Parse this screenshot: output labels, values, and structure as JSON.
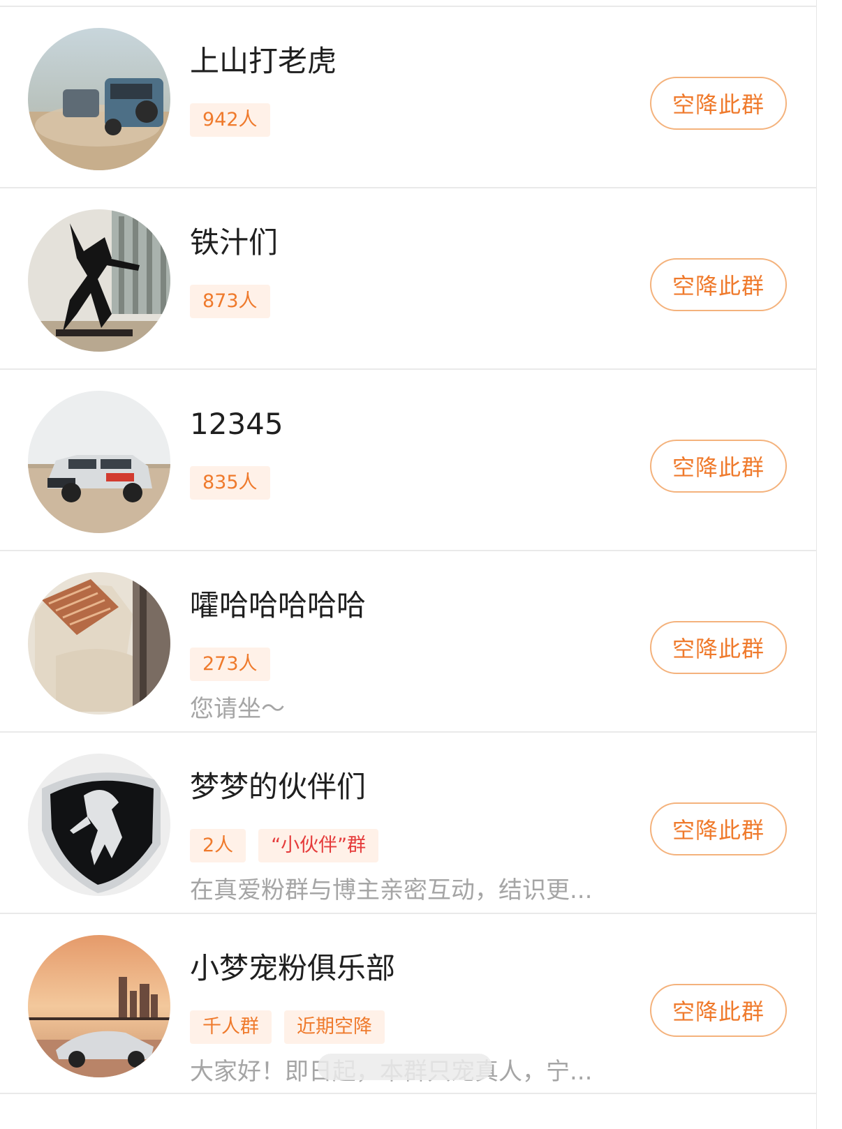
{
  "colors": {
    "accent": "#ef7a2c",
    "tag_bg": "#fff1e8",
    "tag_red": "#e53b3b",
    "divider": "#e9e9e9"
  },
  "groups": [
    {
      "name": "上山打老虎",
      "tags": [
        {
          "label": "942人",
          "style": "orange"
        }
      ],
      "description": "",
      "button": "空降此群",
      "avatar_icon": "off-road-cars-desert-photo"
    },
    {
      "name": "铁汁们",
      "tags": [
        {
          "label": "873人",
          "style": "orange"
        }
      ],
      "description": "",
      "button": "空降此群",
      "avatar_icon": "sculpture-photo"
    },
    {
      "name": "12345",
      "tags": [
        {
          "label": "835人",
          "style": "orange"
        }
      ],
      "description": "",
      "button": "空降此群",
      "avatar_icon": "suv-desert-photo"
    },
    {
      "name": "嚯哈哈哈哈哈",
      "tags": [
        {
          "label": "273人",
          "style": "orange"
        }
      ],
      "description": "您请坐～",
      "button": "空降此群",
      "avatar_icon": "car-seat-pillow-photo"
    },
    {
      "name": "梦梦的伙伴们",
      "tags": [
        {
          "label": "2人",
          "style": "orange"
        },
        {
          "label": "“小伙伴”群",
          "style": "red"
        }
      ],
      "description": "在真爱粉群与博主亲密互动，结识更...",
      "button": "空降此群",
      "avatar_icon": "ferrari-badge-photo"
    },
    {
      "name": "小梦宠粉俱乐部",
      "tags": [
        {
          "label": "千人群",
          "style": "orange"
        },
        {
          "label": "近期空降",
          "style": "orange"
        }
      ],
      "description": "大家好！即日起，本群只宠真人，宁...",
      "button": "空降此群",
      "avatar_icon": "sports-car-sunset-photo"
    }
  ]
}
